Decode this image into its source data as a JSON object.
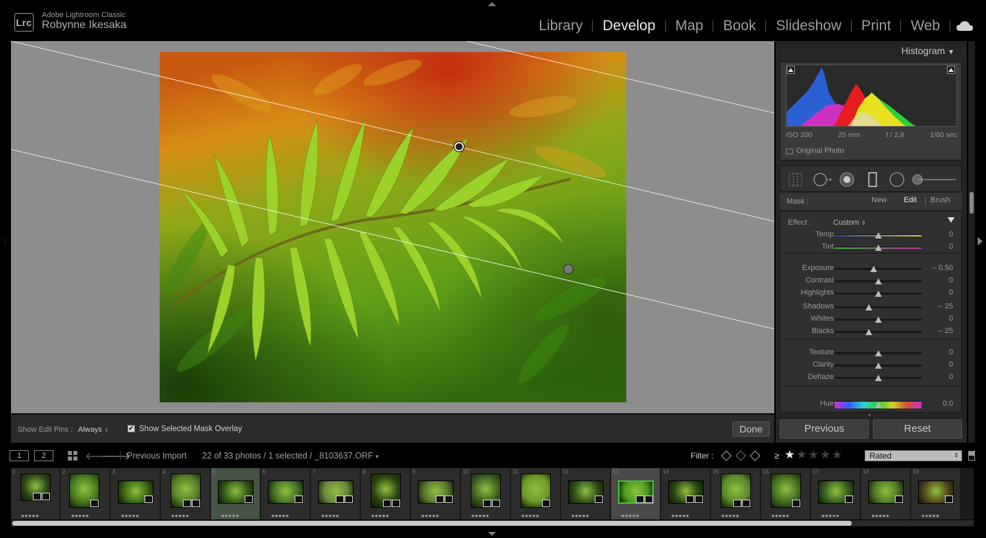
{
  "app": {
    "name": "Adobe Lightroom Classic",
    "logo": "Lrc",
    "user": "Robynne Ikesaka"
  },
  "modules": [
    {
      "label": "Library",
      "active": false
    },
    {
      "label": "Develop",
      "active": true
    },
    {
      "label": "Map",
      "active": false
    },
    {
      "label": "Book",
      "active": false
    },
    {
      "label": "Slideshow",
      "active": false
    },
    {
      "label": "Print",
      "active": false
    },
    {
      "label": "Web",
      "active": false
    }
  ],
  "toolbar": {
    "pins_label": "Show Edit Pins :",
    "pins_value": "Always",
    "overlay_checked": true,
    "overlay_label": "Show Selected Mask Overlay",
    "done_label": "Done"
  },
  "histogram": {
    "title": "Histogram",
    "iso": "ISO 200",
    "focal": "25 mm",
    "aperture": "f / 2.8",
    "shutter": "1/80 sec",
    "original_label": "Original Photo"
  },
  "mask": {
    "label": "Mask :",
    "options": [
      "New",
      "Edit",
      "Brush"
    ],
    "active": "Edit"
  },
  "effect": {
    "label": "Effect :",
    "value": "Custom",
    "sliders": [
      {
        "label": "Temp",
        "value": "0",
        "pos": 0.5
      },
      {
        "label": "Tint",
        "value": "0",
        "pos": 0.5
      },
      {
        "label": "Exposure",
        "value": "– 0.50",
        "pos": 0.45
      },
      {
        "label": "Contrast",
        "value": "0",
        "pos": 0.5
      },
      {
        "label": "Highlights",
        "value": "0",
        "pos": 0.5
      },
      {
        "label": "Shadows",
        "value": "– 25",
        "pos": 0.39
      },
      {
        "label": "Whites",
        "value": "0",
        "pos": 0.5
      },
      {
        "label": "Blacks",
        "value": "– 25",
        "pos": 0.39
      },
      {
        "label": "Texture",
        "value": "0",
        "pos": 0.5
      },
      {
        "label": "Clarity",
        "value": "0",
        "pos": 0.5
      },
      {
        "label": "Dehaze",
        "value": "0",
        "pos": 0.5
      },
      {
        "label": "Hue",
        "value": "0.0",
        "pos": 0.5
      }
    ]
  },
  "buttons": {
    "previous": "Previous",
    "reset": "Reset"
  },
  "filmstrip_bar": {
    "view1": "1",
    "view2": "2",
    "source": "Previous Import",
    "count": "22 of 33 photos / 1 selected / _8103637.ORF",
    "filter_label": "Filter :",
    "rating_op": "≥",
    "rating_stars": 1,
    "rating_mode": "Rated"
  },
  "filmstrip": {
    "selected": 13,
    "frames": [
      "1",
      "2",
      "3",
      "4",
      "5",
      "6",
      "7",
      "8",
      "9",
      "10",
      "11",
      "12",
      "13",
      "14",
      "15",
      "16",
      "17",
      "18",
      "19"
    ]
  },
  "colors": {
    "accent_active": "#ececec",
    "panel_bg": "#252525",
    "view_bg": "#8d8d8d"
  }
}
